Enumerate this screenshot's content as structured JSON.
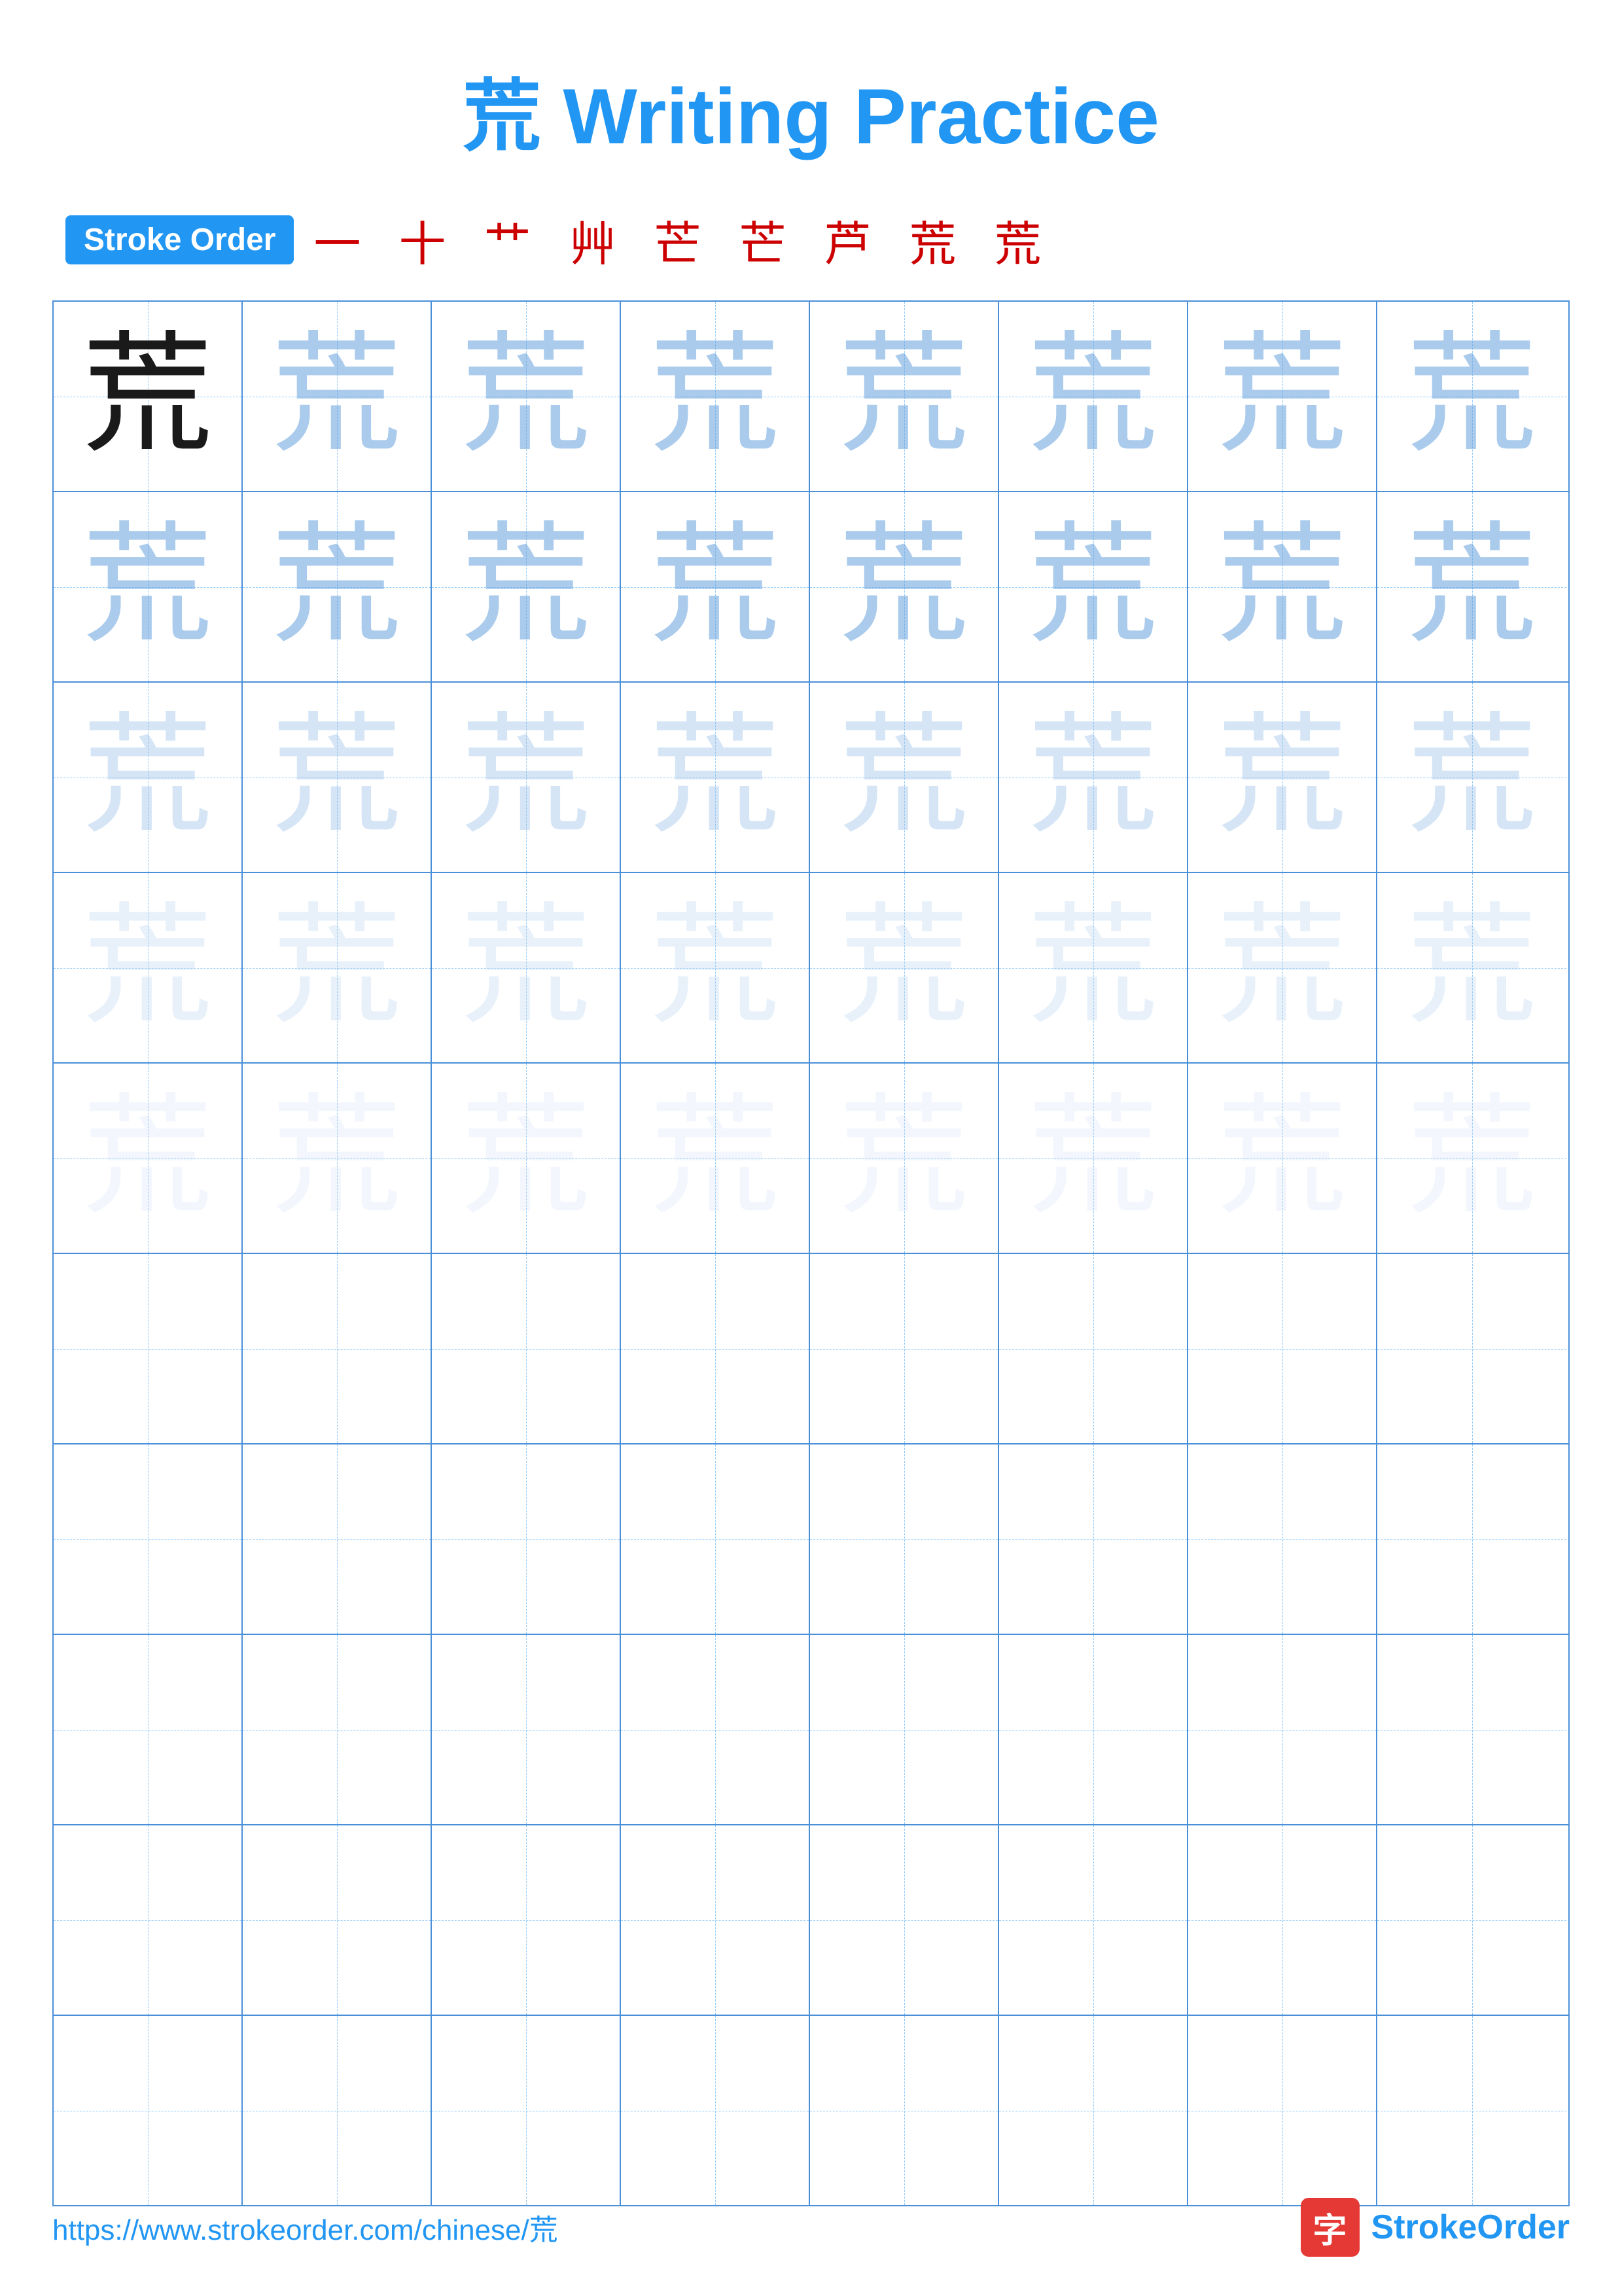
{
  "title": {
    "char": "荒",
    "text": " Writing Practice"
  },
  "stroke_order": {
    "badge_label": "Stroke Order",
    "chars": "一 十 艹 艸 芒 芒 芦 荒 荒"
  },
  "character": "荒",
  "grid": {
    "rows": 10,
    "cols": 8,
    "practice_rows": [
      {
        "type": "dark+fade",
        "dark_index": 0
      },
      {
        "type": "fade1"
      },
      {
        "type": "fade2"
      },
      {
        "type": "fade3"
      },
      {
        "type": "fade4"
      },
      {
        "type": "empty"
      },
      {
        "type": "empty"
      },
      {
        "type": "empty"
      },
      {
        "type": "empty"
      },
      {
        "type": "empty"
      }
    ]
  },
  "footer": {
    "url": "https://www.strokeorder.com/chinese/荒",
    "logo_char": "字",
    "logo_text_part1": "Stroke",
    "logo_text_part2": "Order"
  }
}
